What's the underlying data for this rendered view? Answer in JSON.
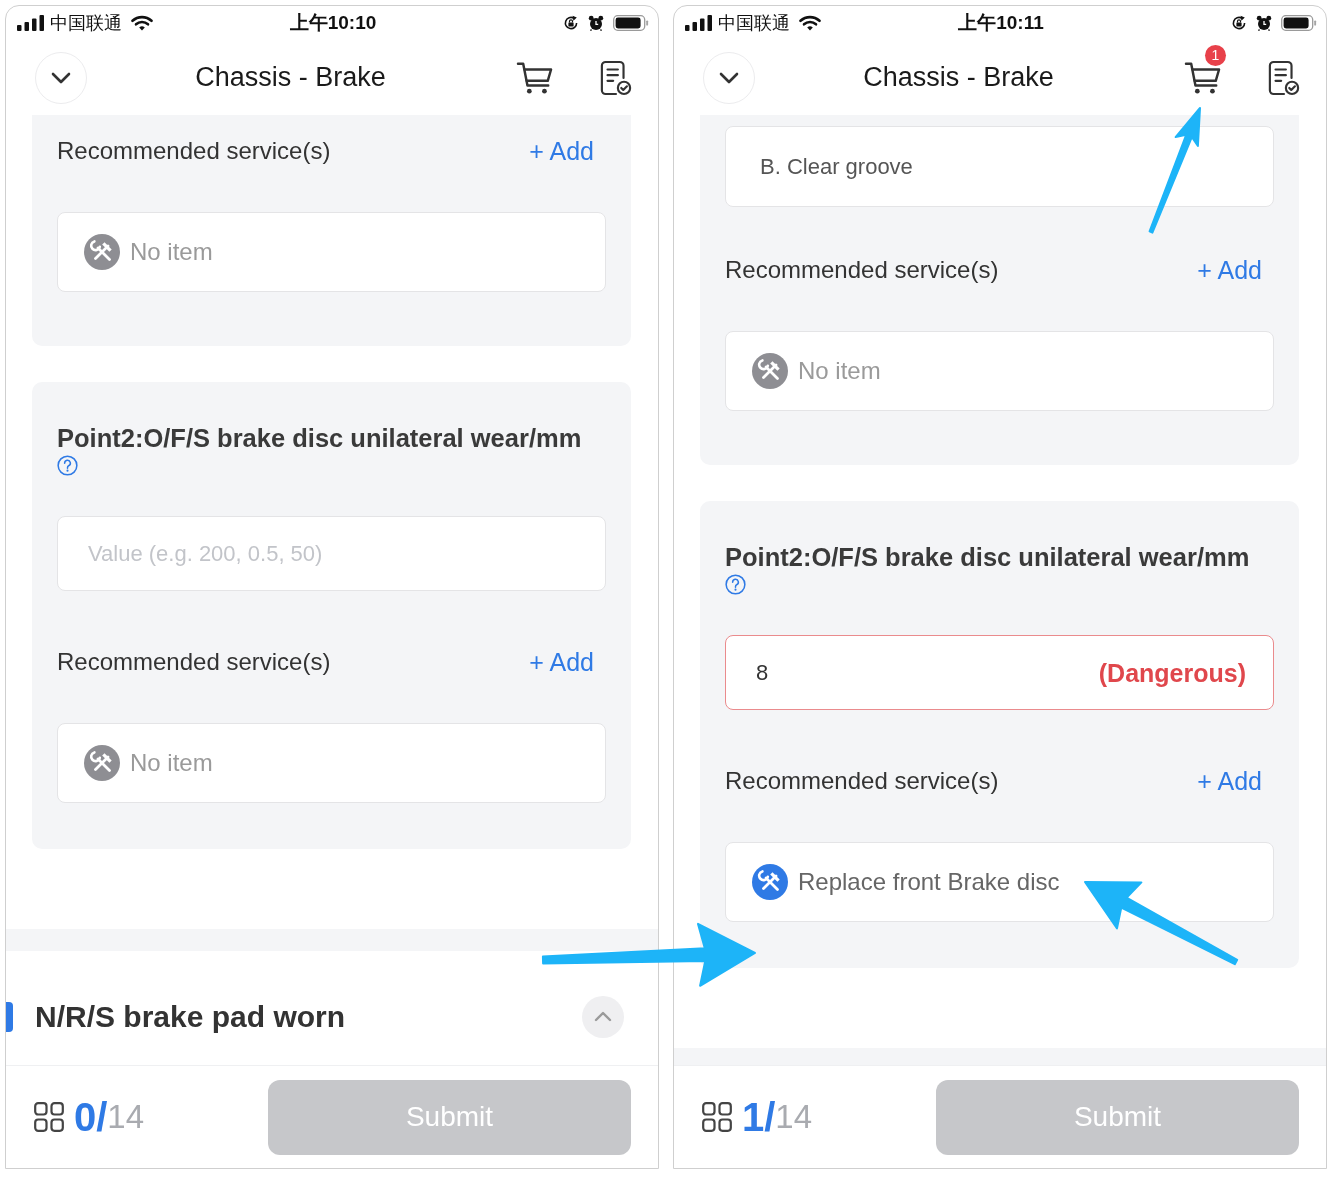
{
  "screens": [
    {
      "status_bar": {
        "carrier": "中国联通",
        "time": "上午10:10"
      },
      "header": {
        "title": "Chassis - Brake"
      },
      "cards": [
        {
          "blocks": [
            {
              "kind": "services",
              "label": "Recommended service(s)",
              "add": "+ Add",
              "items": [
                {
                  "kind": "empty",
                  "text": "No item"
                }
              ]
            }
          ]
        },
        {
          "blocks": [
            {
              "kind": "question",
              "title": "Point2:O/F/S brake disc unilateral wear/mm"
            },
            {
              "kind": "input",
              "placeholder": "Value (e.g. 200, 0.5, 50)",
              "flagged": false
            },
            {
              "kind": "services",
              "label": "Recommended service(s)",
              "add": "+ Add",
              "items": [
                {
                  "kind": "empty",
                  "text": "No item"
                }
              ]
            }
          ]
        }
      ],
      "next_section": {
        "title": "N/R/S brake pad worn",
        "expanded": true
      },
      "footer": {
        "done": "0/",
        "total": "14",
        "submit": {
          "label": "Submit",
          "disabled": true
        }
      }
    },
    {
      "status_bar": {
        "carrier": "中国联通",
        "time": "上午10:11"
      },
      "header": {
        "title": "Chassis - Brake",
        "cart_badge": "1"
      },
      "cards": [
        {
          "blocks": [
            {
              "kind": "option",
              "text": "B. Clear groove"
            },
            {
              "kind": "services",
              "label": "Recommended service(s)",
              "add": "+ Add",
              "items": [
                {
                  "kind": "empty",
                  "text": "No item"
                }
              ]
            }
          ]
        },
        {
          "blocks": [
            {
              "kind": "question",
              "title": "Point2:O/F/S brake disc unilateral wear/mm"
            },
            {
              "kind": "input",
              "value": "8",
              "flagged": true,
              "status_label": "(Dangerous)"
            },
            {
              "kind": "services",
              "label": "Recommended service(s)",
              "add": "+ Add",
              "items": [
                {
                  "kind": "service",
                  "text": "Replace front Brake disc"
                }
              ]
            }
          ]
        }
      ],
      "footer": {
        "done": "1/",
        "total": "14",
        "submit": {
          "label": "Submit",
          "disabled": true
        }
      }
    }
  ]
}
